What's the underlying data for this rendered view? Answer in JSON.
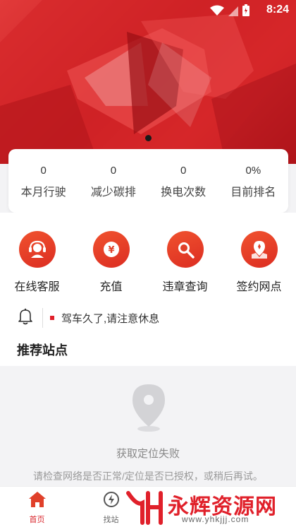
{
  "status_bar": {
    "time": "8:24"
  },
  "banner": {
    "indicator_count": 1
  },
  "stats": [
    {
      "value": "0",
      "label": "本月行驶"
    },
    {
      "value": "0",
      "label": "减少碳排"
    },
    {
      "value": "0",
      "label": "换电次数"
    },
    {
      "value": "0%",
      "label": "目前排名"
    }
  ],
  "services": [
    {
      "label": "在线客服",
      "icon": "headset-icon"
    },
    {
      "label": "充值",
      "icon": "yen-coin-icon"
    },
    {
      "label": "违章查询",
      "icon": "search-icon"
    },
    {
      "label": "签约网点",
      "icon": "location-map-icon"
    }
  ],
  "notice": {
    "text": "驾车久了,请注意休息"
  },
  "section": {
    "title": "推荐站点"
  },
  "empty_state": {
    "title": "获取定位失败",
    "description": "请检查网络是否正常/定位是否已授权，或稍后再试。"
  },
  "tabbar": [
    {
      "label": "首页",
      "active": true
    },
    {
      "label": "找站",
      "active": false
    }
  ],
  "watermark": {
    "title": "永辉资源网",
    "url": "www.yhkjjj.com"
  },
  "colors": {
    "accent": "#d9262c",
    "banner": "#c81e22"
  }
}
